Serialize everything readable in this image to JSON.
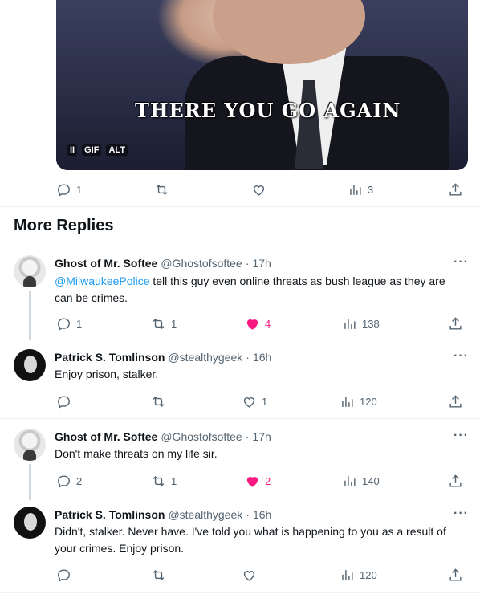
{
  "media": {
    "caption": "THERE YOU GO AGAIN",
    "badges": [
      "II",
      "GIF",
      "ALT"
    ]
  },
  "top_actions": {
    "reply": "1",
    "retweet": "",
    "like": "",
    "views": "3"
  },
  "section_title": "More Replies",
  "posts": [
    {
      "name": "Ghost of Mr. Softee",
      "handle": "@Ghostofsoftee",
      "time": "17h",
      "mention": "@MilwaukeePolice",
      "text_rest": " tell this guy even online threats as bush league as they are can be crimes.",
      "reply": "1",
      "retweet": "1",
      "like": "4",
      "views": "138",
      "liked": true
    },
    {
      "name": "Patrick S. Tomlinson",
      "handle": "@stealthygeek",
      "time": "16h",
      "text": "Enjoy prison, stalker.",
      "reply": "",
      "retweet": "",
      "like": "1",
      "views": "120",
      "liked": false
    },
    {
      "name": "Ghost of Mr. Softee",
      "handle": "@Ghostofsoftee",
      "time": "17h",
      "text": "Don't make threats on my life sir.",
      "reply": "2",
      "retweet": "1",
      "like": "2",
      "views": "140",
      "liked": true
    },
    {
      "name": "Patrick S. Tomlinson",
      "handle": "@stealthygeek",
      "time": "16h",
      "text": "Didn't, stalker. Never have. I've told you what is happening to you as a result of your crimes. Enjoy prison.",
      "reply": "",
      "retweet": "",
      "like": "",
      "views": "120",
      "liked": false
    }
  ],
  "more_glyph": "···",
  "dot": "·"
}
